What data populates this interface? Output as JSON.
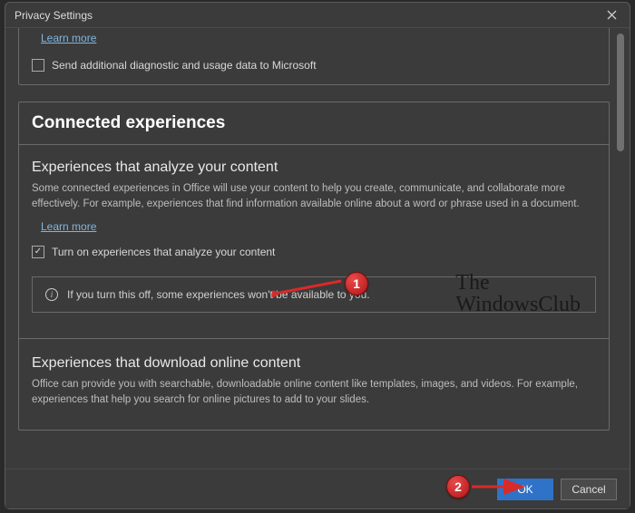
{
  "dialog": {
    "title": "Privacy Settings"
  },
  "diagnostic": {
    "learn_more": "Learn more",
    "checkbox_label": "Send additional diagnostic and usage data to Microsoft",
    "checked": false
  },
  "connected": {
    "heading": "Connected experiences",
    "analyze": {
      "heading": "Experiences that analyze your content",
      "body": "Some connected experiences in Office will use your content to help you create, communicate, and collaborate more effectively. For example, experiences that find information available online about a word or phrase used in a document.",
      "learn_more": "Learn more",
      "checkbox_label": "Turn on experiences that analyze your content",
      "checked": true,
      "info": "If you turn this off, some experiences won't be available to you."
    },
    "download": {
      "heading": "Experiences that download online content",
      "body": "Office can provide you with searchable, downloadable online content like templates, images, and videos. For example, experiences that help you search for online pictures to add to your slides."
    }
  },
  "footer": {
    "ok": "OK",
    "cancel": "Cancel"
  },
  "watermark": {
    "line1": "The",
    "line2": "WindowsClub"
  },
  "annotations": {
    "badge1": "1",
    "badge2": "2"
  }
}
